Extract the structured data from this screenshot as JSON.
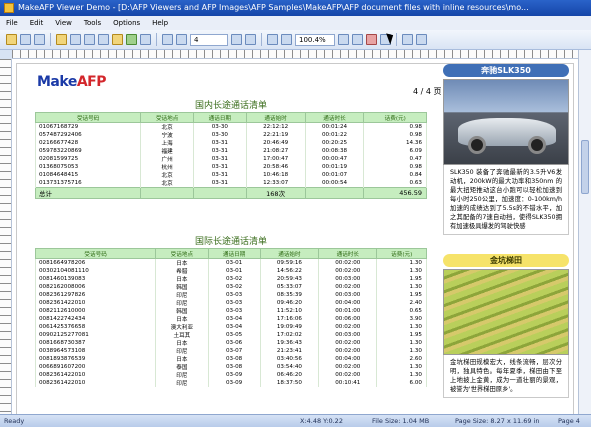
{
  "window": {
    "title": "MakeAFP Viewer Demo - [D:\\AFP Viewers and AFP Images\\AFP Samples\\MakeAFP\\AFP document files with inline resources\\mo..."
  },
  "menu": [
    "File",
    "Edit",
    "View",
    "Tools",
    "Options",
    "Help"
  ],
  "toolbar": {
    "page_field": "4",
    "zoom_field": "100.4%"
  },
  "doc": {
    "logo_make": "Make",
    "logo_afp": "AFP",
    "page_num": "4 / 4 页",
    "domestic": {
      "title": "国内长途通话清单",
      "headers": [
        "受话号码",
        "受话地点",
        "通话日期",
        "通话始时",
        "通话时长",
        "话费(元)"
      ],
      "rows": [
        [
          "01067168729",
          "北京",
          "03-30",
          "22:12:12",
          "00:01:24",
          "0.98"
        ],
        [
          "057487292406",
          "宁波",
          "03-30",
          "22:21:19",
          "00:01:22",
          "0.98"
        ],
        [
          "02166677428",
          "上海",
          "03-31",
          "20:46:49",
          "00:20:25",
          "14.36"
        ],
        [
          "059783220869",
          "福建",
          "03-31",
          "21:08:27",
          "00:08:38",
          "6.09"
        ],
        [
          "02081599725",
          "广州",
          "03-31",
          "17:00:47",
          "00:00:47",
          "0.47"
        ],
        [
          "01368075053",
          "杭州",
          "03-31",
          "20:58:46",
          "00:01:19",
          "0.98"
        ],
        [
          "01084648415",
          "北京",
          "03-31",
          "10:46:18",
          "00:01:07",
          "0.84"
        ],
        [
          "013731375716",
          "北京",
          "03-31",
          "12:33:07",
          "00:00:54",
          "0.63"
        ]
      ],
      "total_label": "总计",
      "total_count": "168次",
      "total_amount": "456.59"
    },
    "intl": {
      "title": "国际长途通话清单",
      "headers": [
        "受话号码",
        "受话地点",
        "通话日期",
        "通话始时",
        "通话时长",
        "话费(元)"
      ],
      "rows": [
        [
          "0081664978206",
          "日本",
          "03-01",
          "09:59:16",
          "00:02:00",
          "1.30"
        ],
        [
          "00302104081110",
          "希腊",
          "03-01",
          "14:56:22",
          "00:02:00",
          "1.30"
        ],
        [
          "0081460139083",
          "日本",
          "03-02",
          "20:59:43",
          "00:03:00",
          "1.95"
        ],
        [
          "0082162008006",
          "韩国",
          "03-02",
          "05:33:07",
          "00:02:00",
          "1.30"
        ],
        [
          "0082361297826",
          "印尼",
          "03-03",
          "08:35:39",
          "00:03:00",
          "1.95"
        ],
        [
          "0082361422010",
          "印尼",
          "03-03",
          "09:46:20",
          "00:04:00",
          "2.40"
        ],
        [
          "0082112610000",
          "韩国",
          "03-03",
          "11:52:10",
          "00:01:00",
          "0.65"
        ],
        [
          "0081422742434",
          "日本",
          "03-04",
          "17:16:06",
          "00:06:00",
          "3.90"
        ],
        [
          "0061425376658",
          "澳大利亚",
          "03-04",
          "19:09:49",
          "00:02:00",
          "1.30"
        ],
        [
          "00902125277081",
          "土耳其",
          "03-05",
          "17:02:02",
          "00:03:00",
          "1.95"
        ],
        [
          "0081668730387",
          "日本",
          "03-06",
          "19:36:43",
          "00:02:00",
          "1.30"
        ],
        [
          "0038964573108",
          "印尼",
          "03-07",
          "21:23:41",
          "00:02:00",
          "1.30"
        ],
        [
          "0081893876539",
          "日本",
          "03-08",
          "03:40:56",
          "00:04:00",
          "2.60"
        ],
        [
          "0066891607200",
          "泰国",
          "03-08",
          "03:54:40",
          "00:02:00",
          "1.30"
        ],
        [
          "0082361422010",
          "印尼",
          "03-09",
          "06:46:20",
          "00:02:00",
          "1.30"
        ],
        [
          "0082361422010",
          "印尼",
          "03-09",
          "18:37:50",
          "00:10:41",
          "6.00"
        ]
      ]
    },
    "side1": {
      "caption": "奔驰SLK350",
      "text": "SLK350 装备了奔驰最新的3.5升V6发动机，200kW的最大功率和350nm 的最大扭矩推动这台小跑可以轻松加速到每小时250公里，加速度：0-100km/h加速的成绩达到了5.5s的不错水平，加之其配备的7速自动挡，使得SLK350拥有加速极具爆发的驾驶快感"
    },
    "side2": {
      "caption": "金坑梯田",
      "text": "金坑梯田规模宏大，线条流畅，层次分明，独具特色。每年夏季，梯田由下至上地披上金黄，成为一道壮丽的景观，被誉为'世界梯田原乡'。"
    }
  },
  "status": {
    "ready": "Ready",
    "coords": "X:4.48  Y:0.22",
    "file_size": "File Size: 1.04 MB",
    "page_size": "Page Size: 8.27 x 11.69 in",
    "page": "Page 4"
  }
}
